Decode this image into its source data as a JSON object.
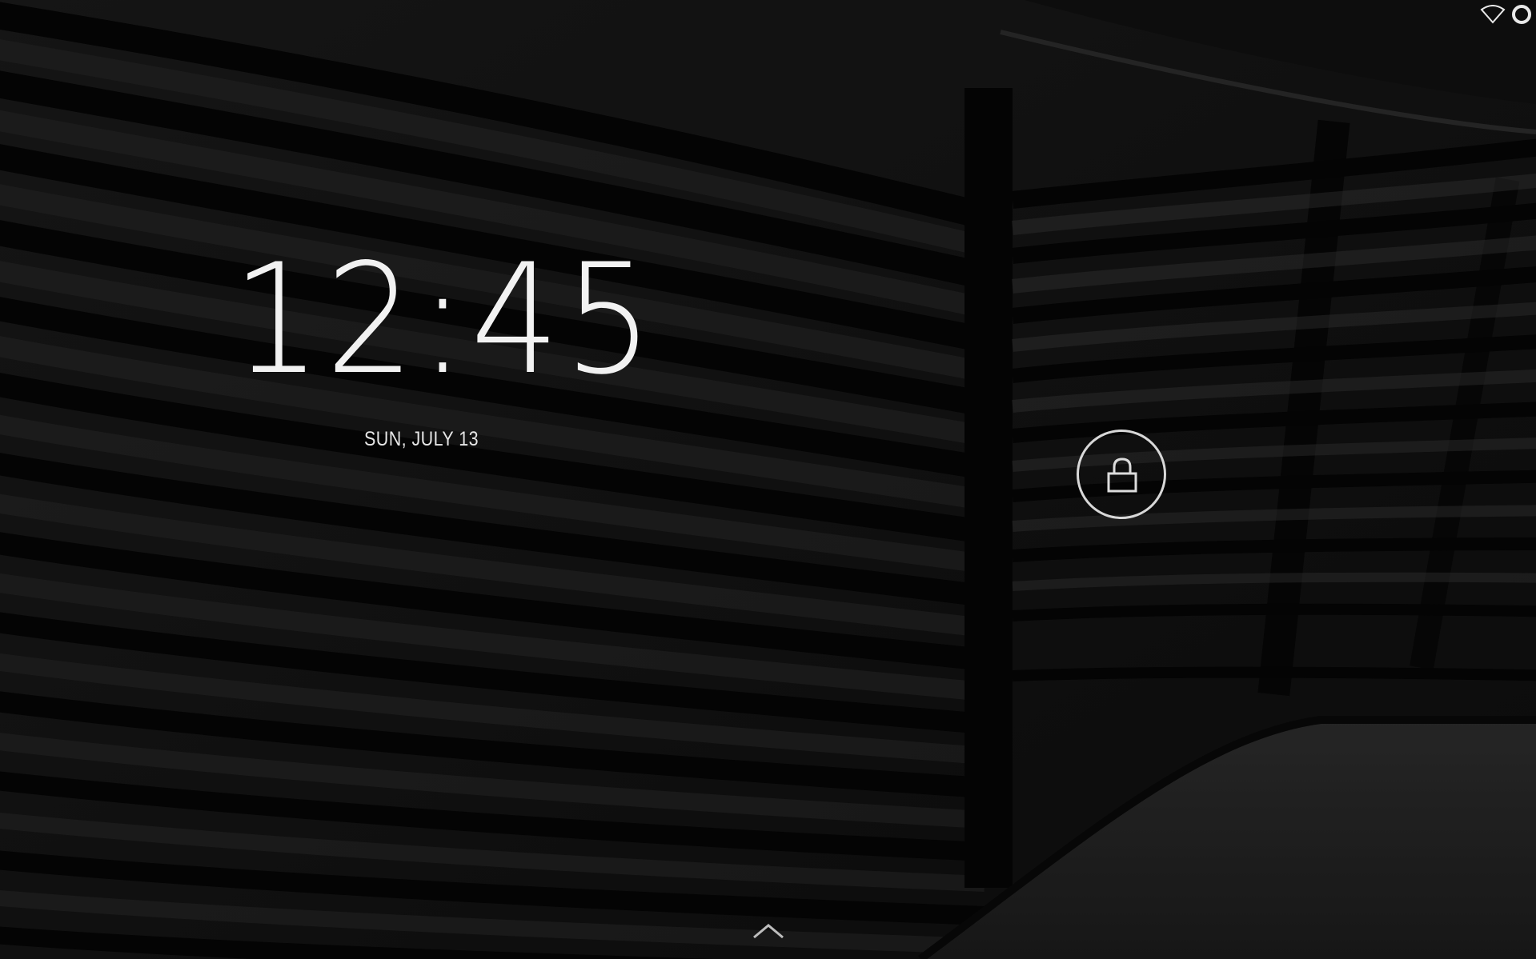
{
  "lockscreen": {
    "time": "12:45",
    "date": "SUN, JULY 13"
  },
  "status_bar": {
    "icons": [
      "wifi-icon",
      "battery-icon"
    ]
  },
  "controls": {
    "unlock_icon": "lock-icon",
    "swipe_icon": "chevron-up-icon"
  },
  "colors": {
    "text": "#f2f2f2",
    "ring": "#d8d8d8",
    "background": "#0d0d0d"
  }
}
